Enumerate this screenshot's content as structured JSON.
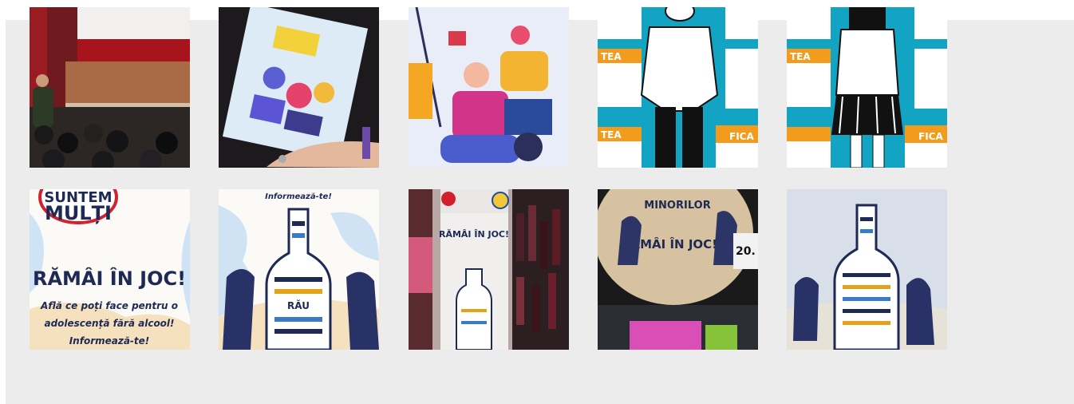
{
  "gallery": {
    "photos": [
      {
        "alt": "",
        "icon": "lecture-photo"
      },
      {
        "alt": "",
        "icon": "brochure-photo"
      },
      {
        "alt": "",
        "icon": "illustration"
      },
      {
        "alt": "",
        "icon": "infographic-boy"
      },
      {
        "alt": "",
        "icon": "infographic-girl"
      },
      {
        "alt": "",
        "icon": "campaign-poster"
      },
      {
        "alt": "",
        "icon": "bottle-poster"
      },
      {
        "alt": "",
        "icon": "store-display"
      },
      {
        "alt": "",
        "icon": "store-sign"
      },
      {
        "alt": "",
        "icon": "bottle-poster-print"
      }
    ],
    "texts": {
      "suntem": "SUNTEM",
      "multi": "MULȚI",
      "ramai": "RĂMÂI ÎN JOC!",
      "afla1": "Află ce poți face pentru o",
      "afla2": "adolescență fără alcool!",
      "informeaza": "Informează-te!",
      "ramai_small": "RĂMÂI ÎN JOC!",
      "minorilor": "MINORILOR",
      "tea": "TEA",
      "fica": "FICA",
      "price": "20.",
      "bottle_word": "RĂU"
    },
    "colors": {
      "background": "#ececec",
      "accent": "#9fd3f2",
      "infographic_teal": "#12a4c2",
      "infographic_orange": "#f39b1c"
    }
  }
}
